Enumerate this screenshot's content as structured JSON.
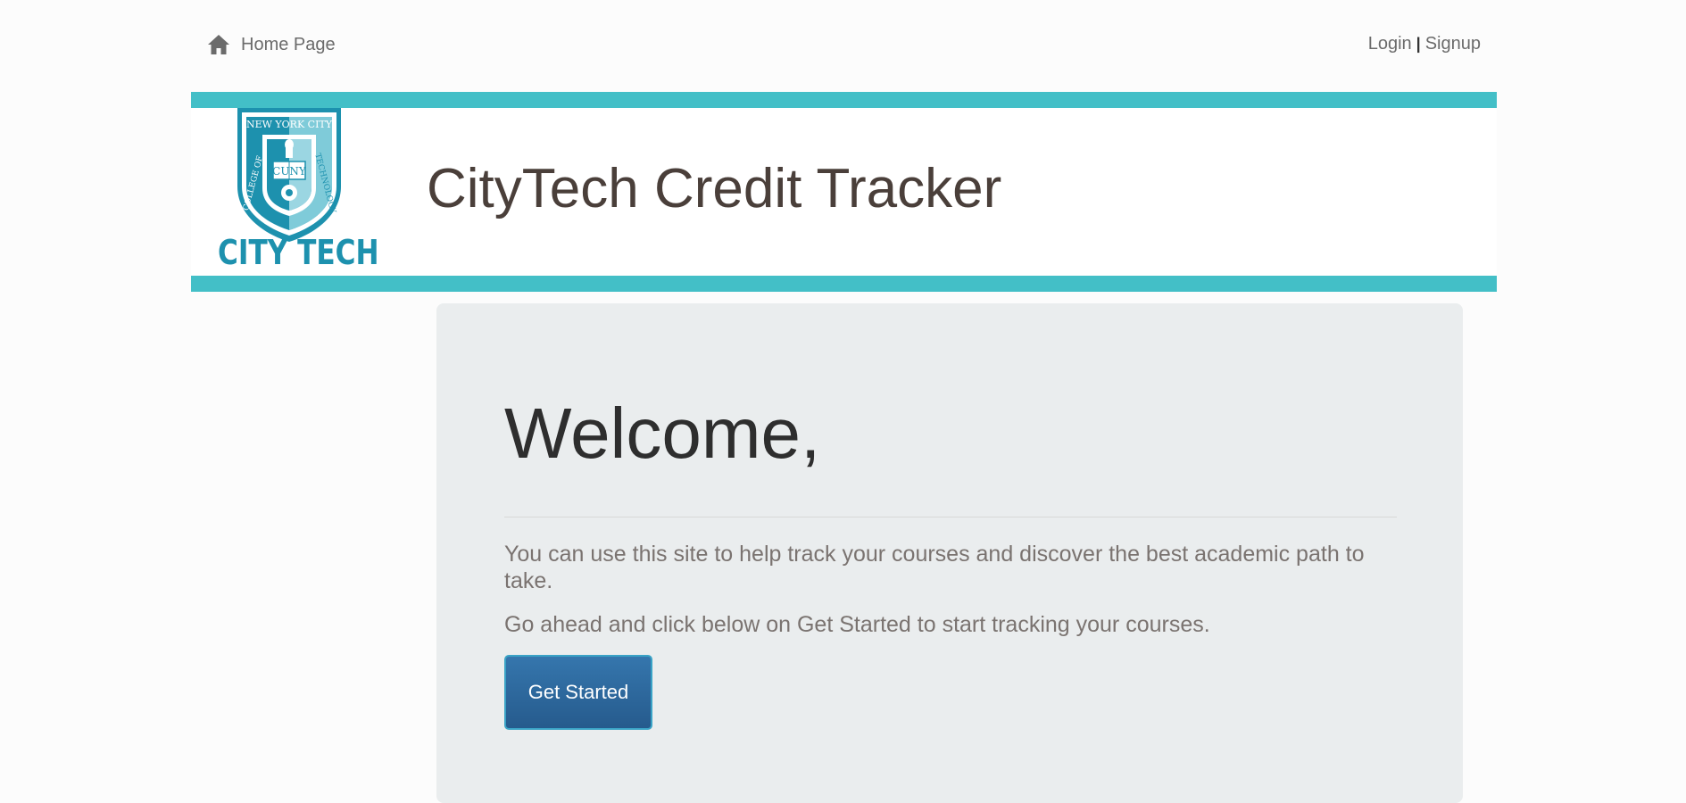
{
  "nav": {
    "home_label": "Home Page",
    "login_label": "Login",
    "separator": "|",
    "signup_label": "Signup"
  },
  "header": {
    "logo_text": "CITY TECH",
    "logo_seal_text": "NEW YORK CITY COLLEGE OF TECHNOLOGY CUNY",
    "site_title": "CityTech Credit Tracker"
  },
  "main": {
    "heading": "Welcome,",
    "paragraph1": "You can use this site to help track your courses and discover the best academic path to take.",
    "paragraph2": "Go ahead and click below on Get Started to start tracking your courses.",
    "button_label": "Get Started"
  },
  "colors": {
    "accent_band": "#43bfc7",
    "logo_teal": "#1d91ae",
    "button_blue": "#2d67a0",
    "panel_bg": "#eaedee"
  },
  "icons": {
    "home": "home-icon"
  }
}
